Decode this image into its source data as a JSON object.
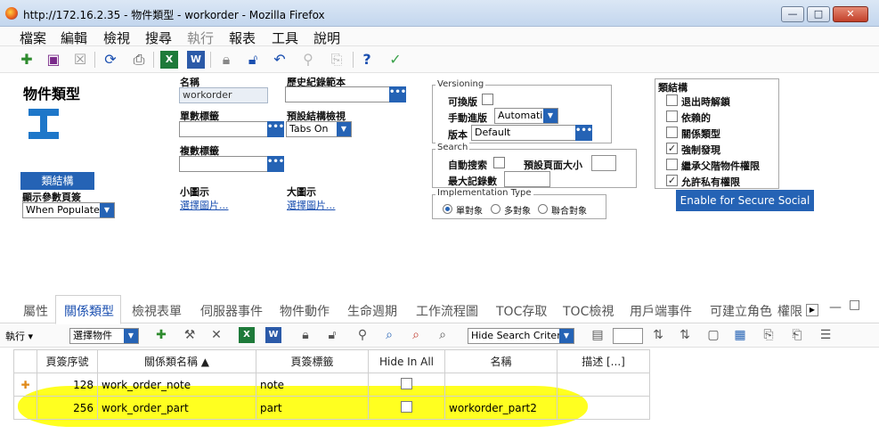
{
  "window": {
    "title": "http://172.16.2.35 - 物件類型 - workorder - Mozilla Firefox",
    "buttons": {
      "minimize": "—",
      "maximize": "□",
      "close": "✕"
    }
  },
  "menu": [
    "檔案",
    "編輯",
    "檢視",
    "搜尋",
    "執行",
    "報表",
    "工具",
    "說明"
  ],
  "toolbar_icons": [
    "new-icon",
    "save-icon",
    "delete-icon",
    "refresh-icon",
    "print-icon",
    "excel-icon",
    "word-icon",
    "lock-icon",
    "unlock-icon",
    "undo-icon",
    "link-icon",
    "copy-icon",
    "help-icon",
    "check-icon"
  ],
  "form": {
    "title": "物件類型",
    "name_label": "名稱",
    "name_value": "workorder",
    "history_label": "歷史紀錄範本",
    "single_label": "單數標籤",
    "preset_view_label": "預設結構檢視",
    "preset_view_value": "Tabs On",
    "plural_label": "複數標籤",
    "small_icon_label": "小圖示",
    "small_icon_link": "選擇圖片...",
    "large_icon_label": "大圖示",
    "large_icon_link": "選擇圖片...",
    "class_structure_button": "類結構",
    "display_params_label": "顯示參數頁簽",
    "display_params_value": "When Populated"
  },
  "versioning": {
    "legend": "Versioning",
    "versionable_label": "可換版",
    "manual_label": "手動進版",
    "manual_value": "Automatic",
    "version_label": "版本",
    "version_value": "Default"
  },
  "search": {
    "legend": "Search",
    "auto_label": "自動搜索",
    "page_size_label": "預設頁面大小",
    "max_records_label": "最大記錄數"
  },
  "implementation": {
    "legend": "Implementation Type",
    "options": [
      "單對象",
      "多對象",
      "聯合對象"
    ],
    "selected": "單對象"
  },
  "class_structure": {
    "heading": "類結構",
    "items": [
      {
        "label": "退出時解鎖",
        "checked": false
      },
      {
        "label": "依賴的",
        "checked": false
      },
      {
        "label": "關係類型",
        "checked": false
      },
      {
        "label": "強制發現",
        "checked": true
      },
      {
        "label": "繼承父階物件權限",
        "checked": false
      },
      {
        "label": "允許私有權限",
        "checked": true
      }
    ],
    "secure_social_button": "Enable for Secure Social"
  },
  "tabs": [
    "屬性",
    "關係類型",
    "檢視表單",
    "伺服器事件",
    "物件動作",
    "生命週期",
    "工作流程圖",
    "TOC存取",
    "TOC檢視",
    "用戶端事件",
    "可建立角色",
    "權限"
  ],
  "active_tab": "關係類型",
  "grid_toolbar": {
    "execute_label": "執行",
    "select_item_value": "選擇物件",
    "hide_search_value": "Hide Search Criteria"
  },
  "grid": {
    "columns": [
      "頁簽序號",
      "關係類名稱 ▲",
      "頁簽標籤",
      "Hide In All",
      "名稱",
      "描述 [...]"
    ],
    "rows": [
      {
        "seq": "128",
        "name": "work_order_note",
        "label": "note",
        "hide": false,
        "rel_name": "",
        "desc": ""
      },
      {
        "seq": "256",
        "name": "work_order_part",
        "label": "part",
        "hide": false,
        "rel_name": "workorder_part2",
        "desc": ""
      }
    ]
  },
  "colors": {
    "accent": "#2563b5",
    "highlight": "#ffff20",
    "link": "#1a4fb0"
  }
}
